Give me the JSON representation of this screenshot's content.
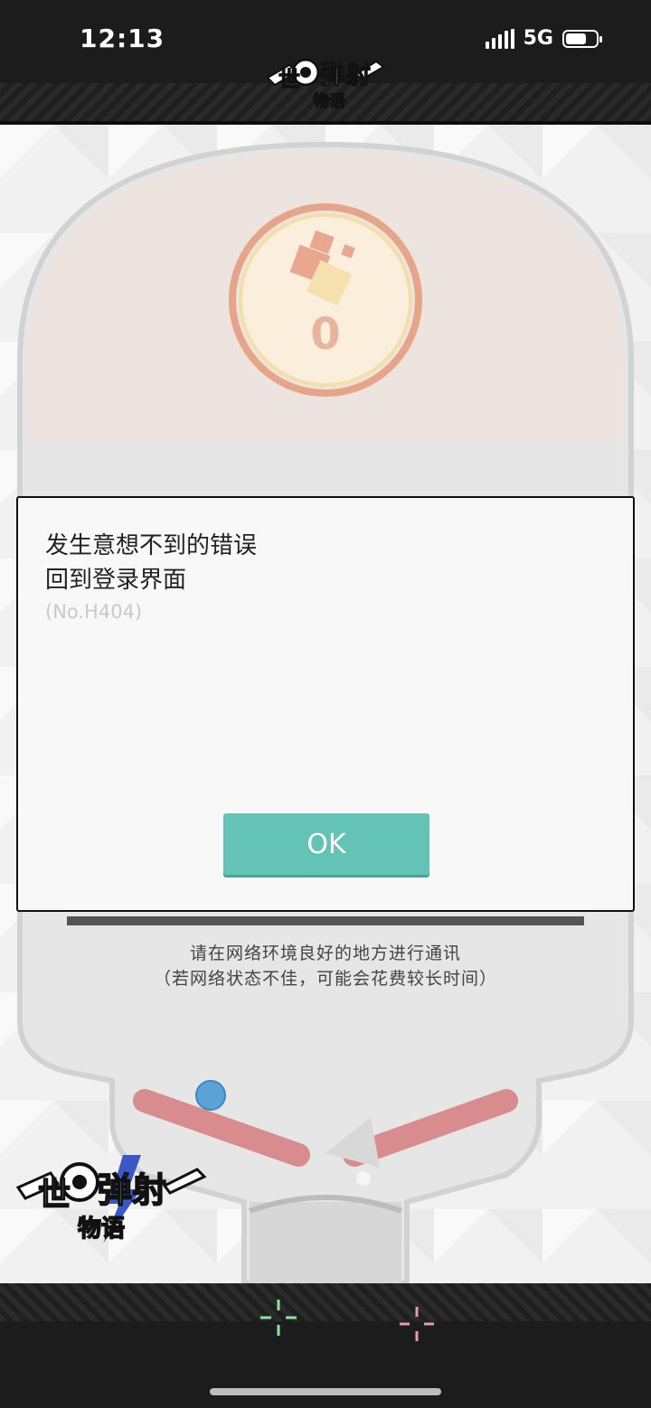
{
  "status_bar": {
    "time": "12:13",
    "network": "5G"
  },
  "header": {
    "logo_text": "世界弹射物语"
  },
  "score": {
    "value": "0"
  },
  "dialog": {
    "line1": "发生意想不到的错误",
    "line2": "回到登录界面",
    "error_code": "(No.H404)",
    "ok_label": "OK"
  },
  "notice": {
    "line1": "请在网络环境良好的地方进行通讯",
    "line2": "（若网络状态不佳，可能会花费较长时间）"
  },
  "footer": {
    "logo_text": "世界弹射物语"
  },
  "colors": {
    "ok_button": "#62c3b6",
    "flipper": "#d98c8e",
    "ball": "#5ba3d6",
    "score_ring": "#e6a589"
  },
  "icons": {
    "crosshair_left": "crosshair-green-icon",
    "crosshair_right": "crosshair-pink-icon"
  }
}
